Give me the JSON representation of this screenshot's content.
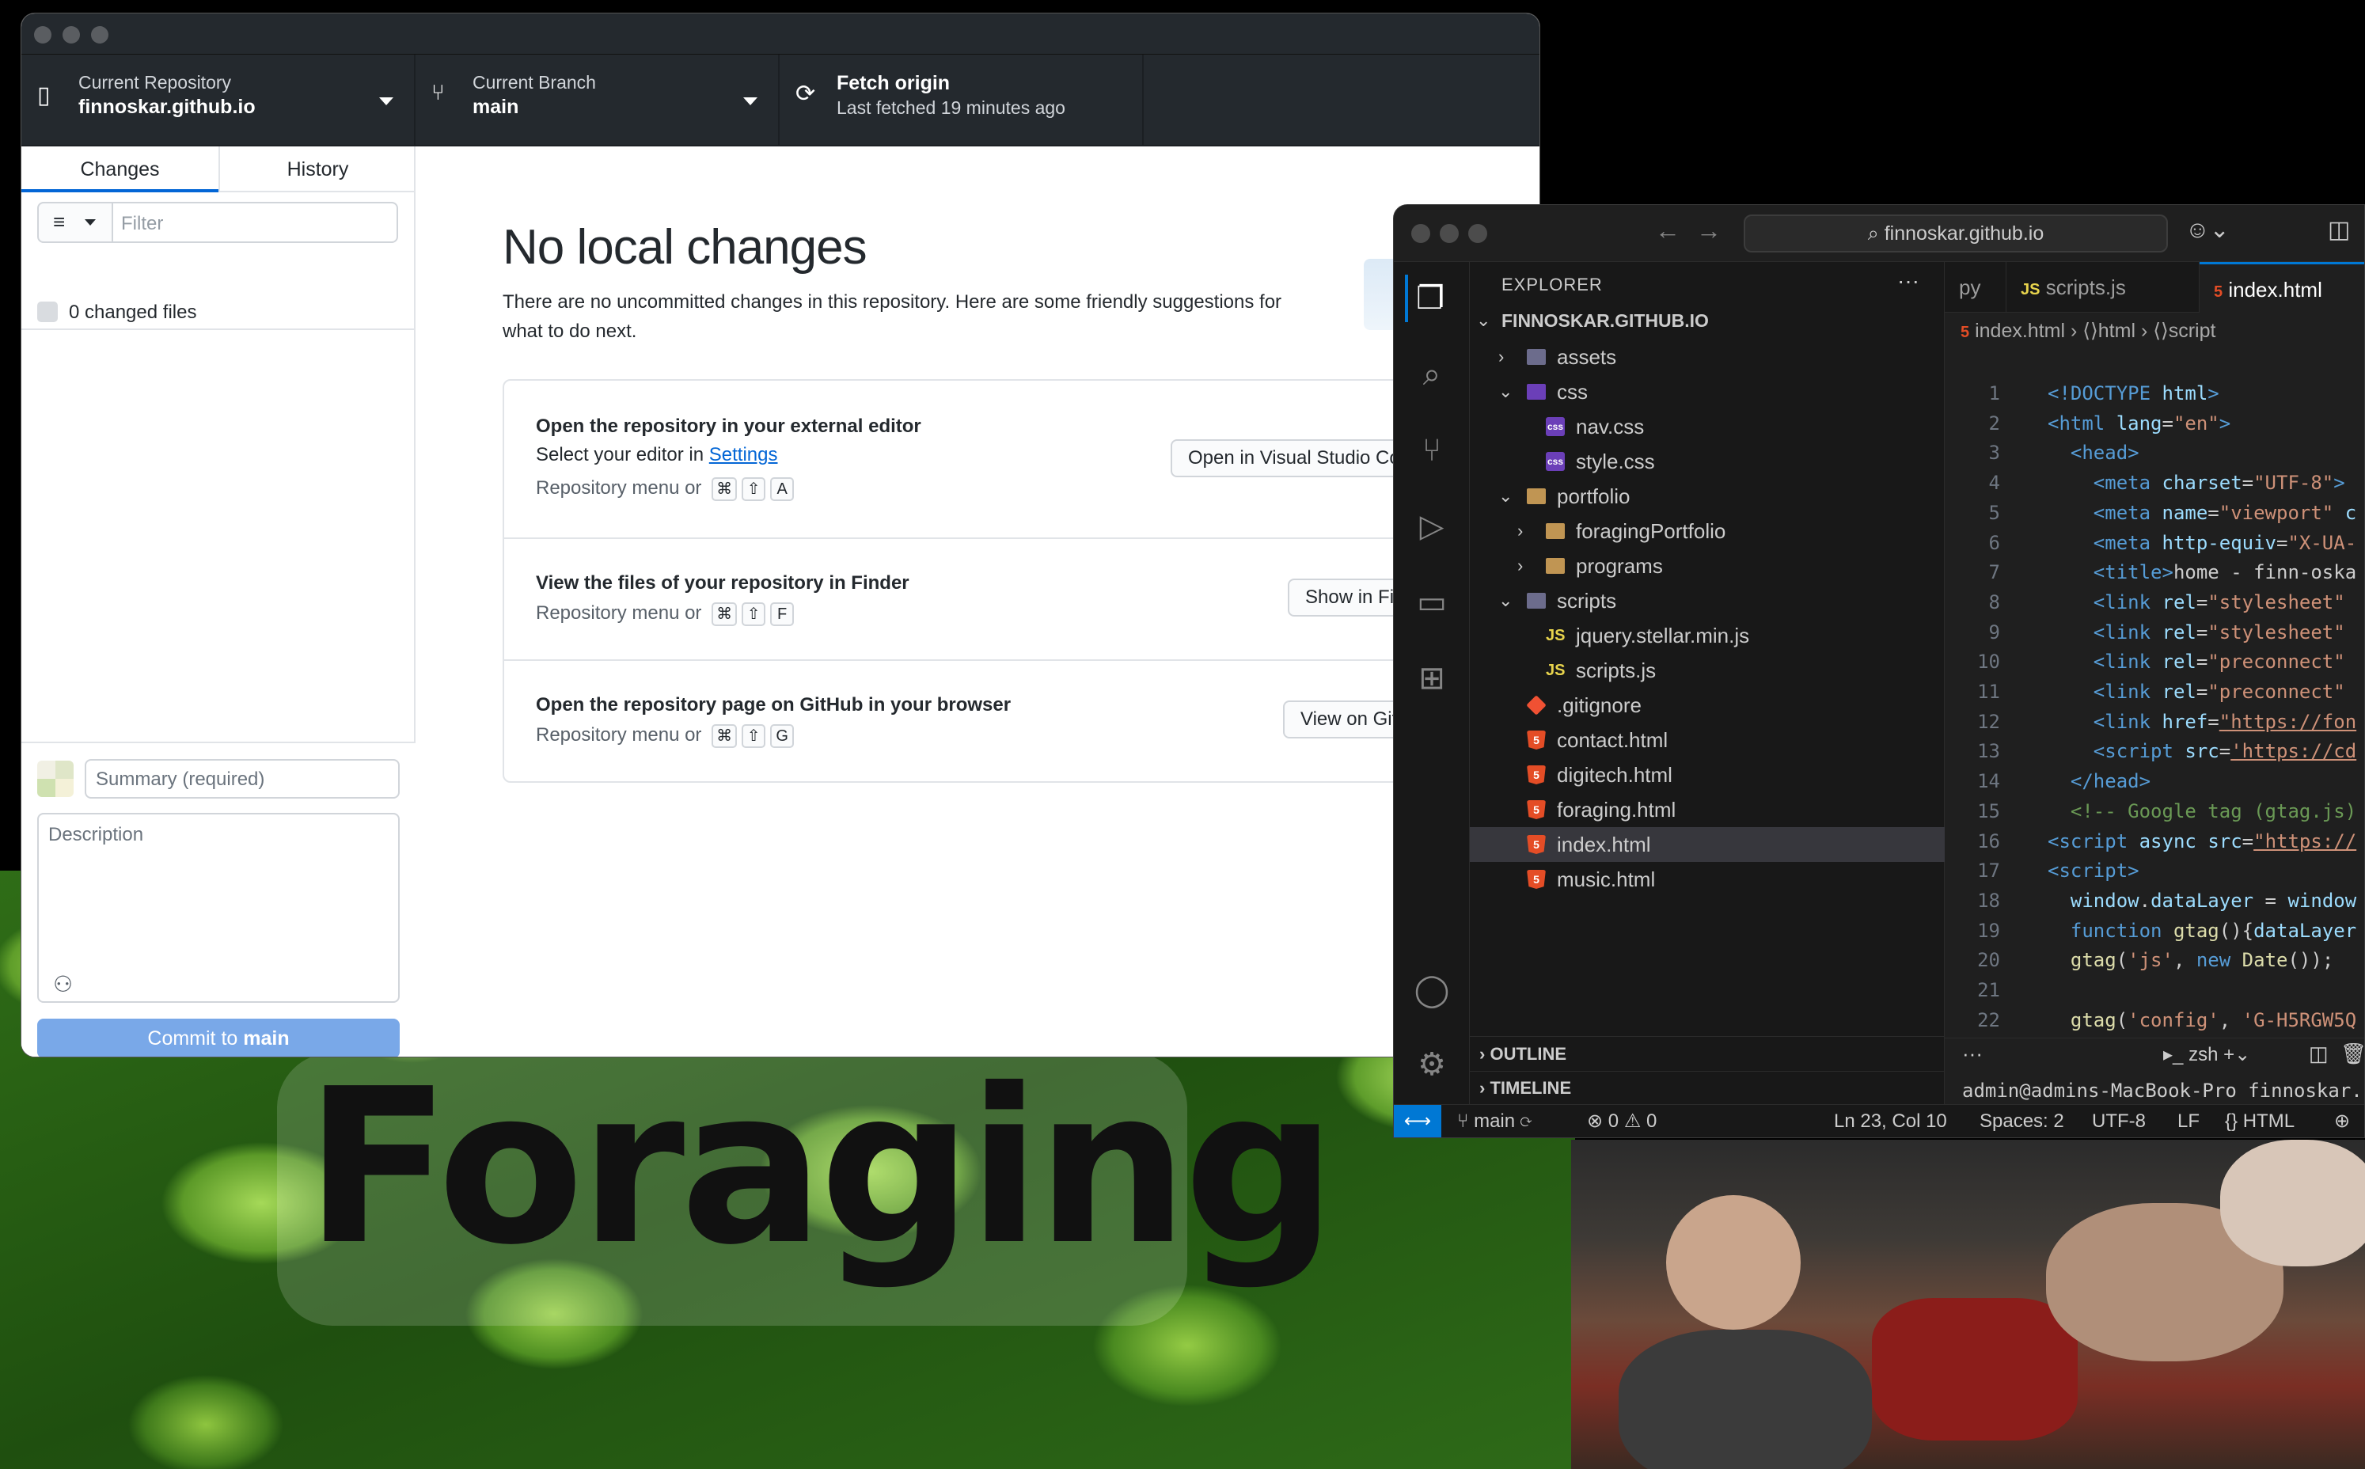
{
  "desktop": {
    "foraging_heading": "Foraging"
  },
  "github_desktop": {
    "toolbar": {
      "repo_label": "Current Repository",
      "repo_value": "finnoskar.github.io",
      "branch_label": "Current Branch",
      "branch_value": "main",
      "fetch_label": "Fetch origin",
      "fetch_status": "Last fetched 19 minutes ago"
    },
    "sidebar": {
      "tabs": [
        "Changes",
        "History"
      ],
      "filter_placeholder": "Filter",
      "changed_files": "0 changed files",
      "summary_placeholder": "Summary (required)",
      "description_placeholder": "Description",
      "commit_prefix": "Commit to ",
      "commit_branch": "main"
    },
    "main": {
      "title": "No local changes",
      "description": "There are no uncommitted changes in this repository. Here are some friendly suggestions for what to do next.",
      "suggestions": [
        {
          "title": "Open the repository in your external editor",
          "subtitle_prefix": "Select your editor in ",
          "subtitle_link": "Settings",
          "hint": "Repository menu or",
          "keys": [
            "⌘",
            "⇧",
            "A"
          ],
          "button": "Open in Visual Studio Code"
        },
        {
          "title": "View the files of your repository in Finder",
          "hint": "Repository menu or",
          "keys": [
            "⌘",
            "⇧",
            "F"
          ],
          "button": "Show in Finder"
        },
        {
          "title": "Open the repository page on GitHub in your browser",
          "hint": "Repository menu or",
          "keys": [
            "⌘",
            "⇧",
            "G"
          ],
          "button": "View on GitHub"
        }
      ]
    }
  },
  "vscode": {
    "search_text": "finnoskar.github.io",
    "explorer_label": "EXPLORER",
    "root_folder": "FINNOSKAR.GITHUB.IO",
    "tree": [
      {
        "label": "assets",
        "icon": "folder-special-icon",
        "chev": "›",
        "depth": 1
      },
      {
        "label": "css",
        "icon": "folder-css-icon",
        "chev": "⌄",
        "depth": 1
      },
      {
        "label": "nav.css",
        "icon": "css-file-icon",
        "chev": "",
        "depth": 2
      },
      {
        "label": "style.css",
        "icon": "css-file-icon",
        "chev": "",
        "depth": 2
      },
      {
        "label": "portfolio",
        "icon": "folder-icon",
        "chev": "⌄",
        "depth": 1
      },
      {
        "label": "foragingPortfolio",
        "icon": "folder-icon",
        "chev": "›",
        "depth": 2
      },
      {
        "label": "programs",
        "icon": "folder-icon",
        "chev": "›",
        "depth": 2
      },
      {
        "label": "scripts",
        "icon": "folder-scripts-icon",
        "chev": "⌄",
        "depth": 1
      },
      {
        "label": "jquery.stellar.min.js",
        "icon": "js-file-icon",
        "chev": "",
        "depth": 2
      },
      {
        "label": "scripts.js",
        "icon": "js-file-icon",
        "chev": "",
        "depth": 2
      },
      {
        "label": ".gitignore",
        "icon": "git-file-icon",
        "chev": "",
        "depth": 1
      },
      {
        "label": "contact.html",
        "icon": "html-file-icon",
        "chev": "",
        "depth": 1
      },
      {
        "label": "digitech.html",
        "icon": "html-file-icon",
        "chev": "",
        "depth": 1
      },
      {
        "label": "foraging.html",
        "icon": "html-file-icon",
        "chev": "",
        "depth": 1
      },
      {
        "label": "index.html",
        "icon": "html-file-icon",
        "chev": "",
        "depth": 1,
        "selected": true
      },
      {
        "label": "music.html",
        "icon": "html-file-icon",
        "chev": "",
        "depth": 1
      }
    ],
    "outline_label": "OUTLINE",
    "timeline_label": "TIMELINE",
    "tabs": [
      {
        "label": "py",
        "icon": ""
      },
      {
        "label": "scripts.js",
        "icon": "JS"
      },
      {
        "label": "index.html",
        "icon": "5",
        "active": true
      }
    ],
    "breadcrumbs": [
      "index.html",
      "html",
      "script"
    ],
    "code": [
      {
        "n": "1",
        "html": "<span class='t-tag'>&lt;!DOCTYPE</span> <span class='t-attr'>html</span><span class='t-tag'>&gt;</span>"
      },
      {
        "n": "2",
        "html": "<span class='t-tag'>&lt;html</span> <span class='t-attr'>lang</span>=<span class='t-str'>\"en\"</span><span class='t-tag'>&gt;</span>"
      },
      {
        "n": "3",
        "html": "  <span class='t-tag'>&lt;head&gt;</span>"
      },
      {
        "n": "4",
        "html": "    <span class='t-tag'>&lt;meta</span> <span class='t-attr'>charset</span>=<span class='t-str'>\"UTF-8\"</span><span class='t-tag'>&gt;</span>"
      },
      {
        "n": "5",
        "html": "    <span class='t-tag'>&lt;meta</span> <span class='t-attr'>name</span>=<span class='t-str'>\"viewport\"</span> <span class='t-attr'>c</span>"
      },
      {
        "n": "6",
        "html": "    <span class='t-tag'>&lt;meta</span> <span class='t-attr'>http-equiv</span>=<span class='t-str'>\"X-UA-</span>"
      },
      {
        "n": "7",
        "html": "    <span class='t-tag'>&lt;title&gt;</span>home - finn-oska"
      },
      {
        "n": "8",
        "html": "    <span class='t-tag'>&lt;link</span> <span class='t-attr'>rel</span>=<span class='t-str'>\"stylesheet\"</span>"
      },
      {
        "n": "9",
        "html": "    <span class='t-tag'>&lt;link</span> <span class='t-attr'>rel</span>=<span class='t-str'>\"stylesheet\"</span>"
      },
      {
        "n": "10",
        "html": "    <span class='t-tag'>&lt;link</span> <span class='t-attr'>rel</span>=<span class='t-str'>\"preconnect\"</span>"
      },
      {
        "n": "11",
        "html": "    <span class='t-tag'>&lt;link</span> <span class='t-attr'>rel</span>=<span class='t-str'>\"preconnect\"</span>"
      },
      {
        "n": "12",
        "html": "    <span class='t-tag'>&lt;link</span> <span class='t-attr'>href</span>=<span class='t-url'>\"https://fon</span>"
      },
      {
        "n": "13",
        "html": "    <span class='t-tag'>&lt;script</span> <span class='t-attr'>src</span>=<span class='t-url'>'https://cd</span>"
      },
      {
        "n": "14",
        "html": "  <span class='t-tag'>&lt;/head&gt;</span>"
      },
      {
        "n": "15",
        "html": "  <span class='t-com'>&lt;!-- Google tag (gtag.js)</span>"
      },
      {
        "n": "16",
        "html": "<span class='t-tag'>&lt;script</span> <span class='t-attr'>async</span> <span class='t-attr'>src</span>=<span class='t-url'>\"https://</span>"
      },
      {
        "n": "17",
        "html": "<span class='t-tag'>&lt;script&gt;</span>"
      },
      {
        "n": "18",
        "html": "  <span class='t-attr'>window</span>.<span class='t-attr'>dataLayer</span> = <span class='t-attr'>window</span>"
      },
      {
        "n": "19",
        "html": "  <span class='t-kw'>function</span> <span class='t-fn'>gtag</span>(){<span class='t-attr'>dataLayer</span>"
      },
      {
        "n": "20",
        "html": "  <span class='t-fn'>gtag</span>(<span class='t-str'>'js'</span>, <span class='t-kw'>new</span> <span class='t-fn'>Date</span>());"
      },
      {
        "n": "21",
        "html": ""
      },
      {
        "n": "22",
        "html": "  <span class='t-fn'>gtag</span>(<span class='t-str'>'config'</span>, <span class='t-str'>'G-H5RGW5Q</span>"
      }
    ],
    "terminal": {
      "shell": "zsh",
      "lines": "admin@admins-MacBook-Pro finnoskar.\nadmin@admins-MacBook-Pro finnoskar.\n%"
    },
    "status": {
      "branch": "main",
      "errors": "0",
      "warnings": "0",
      "position": "Ln 23, Col 10",
      "spaces": "Spaces: 2",
      "encoding": "UTF-8",
      "eol": "LF",
      "language": "HTML"
    }
  }
}
